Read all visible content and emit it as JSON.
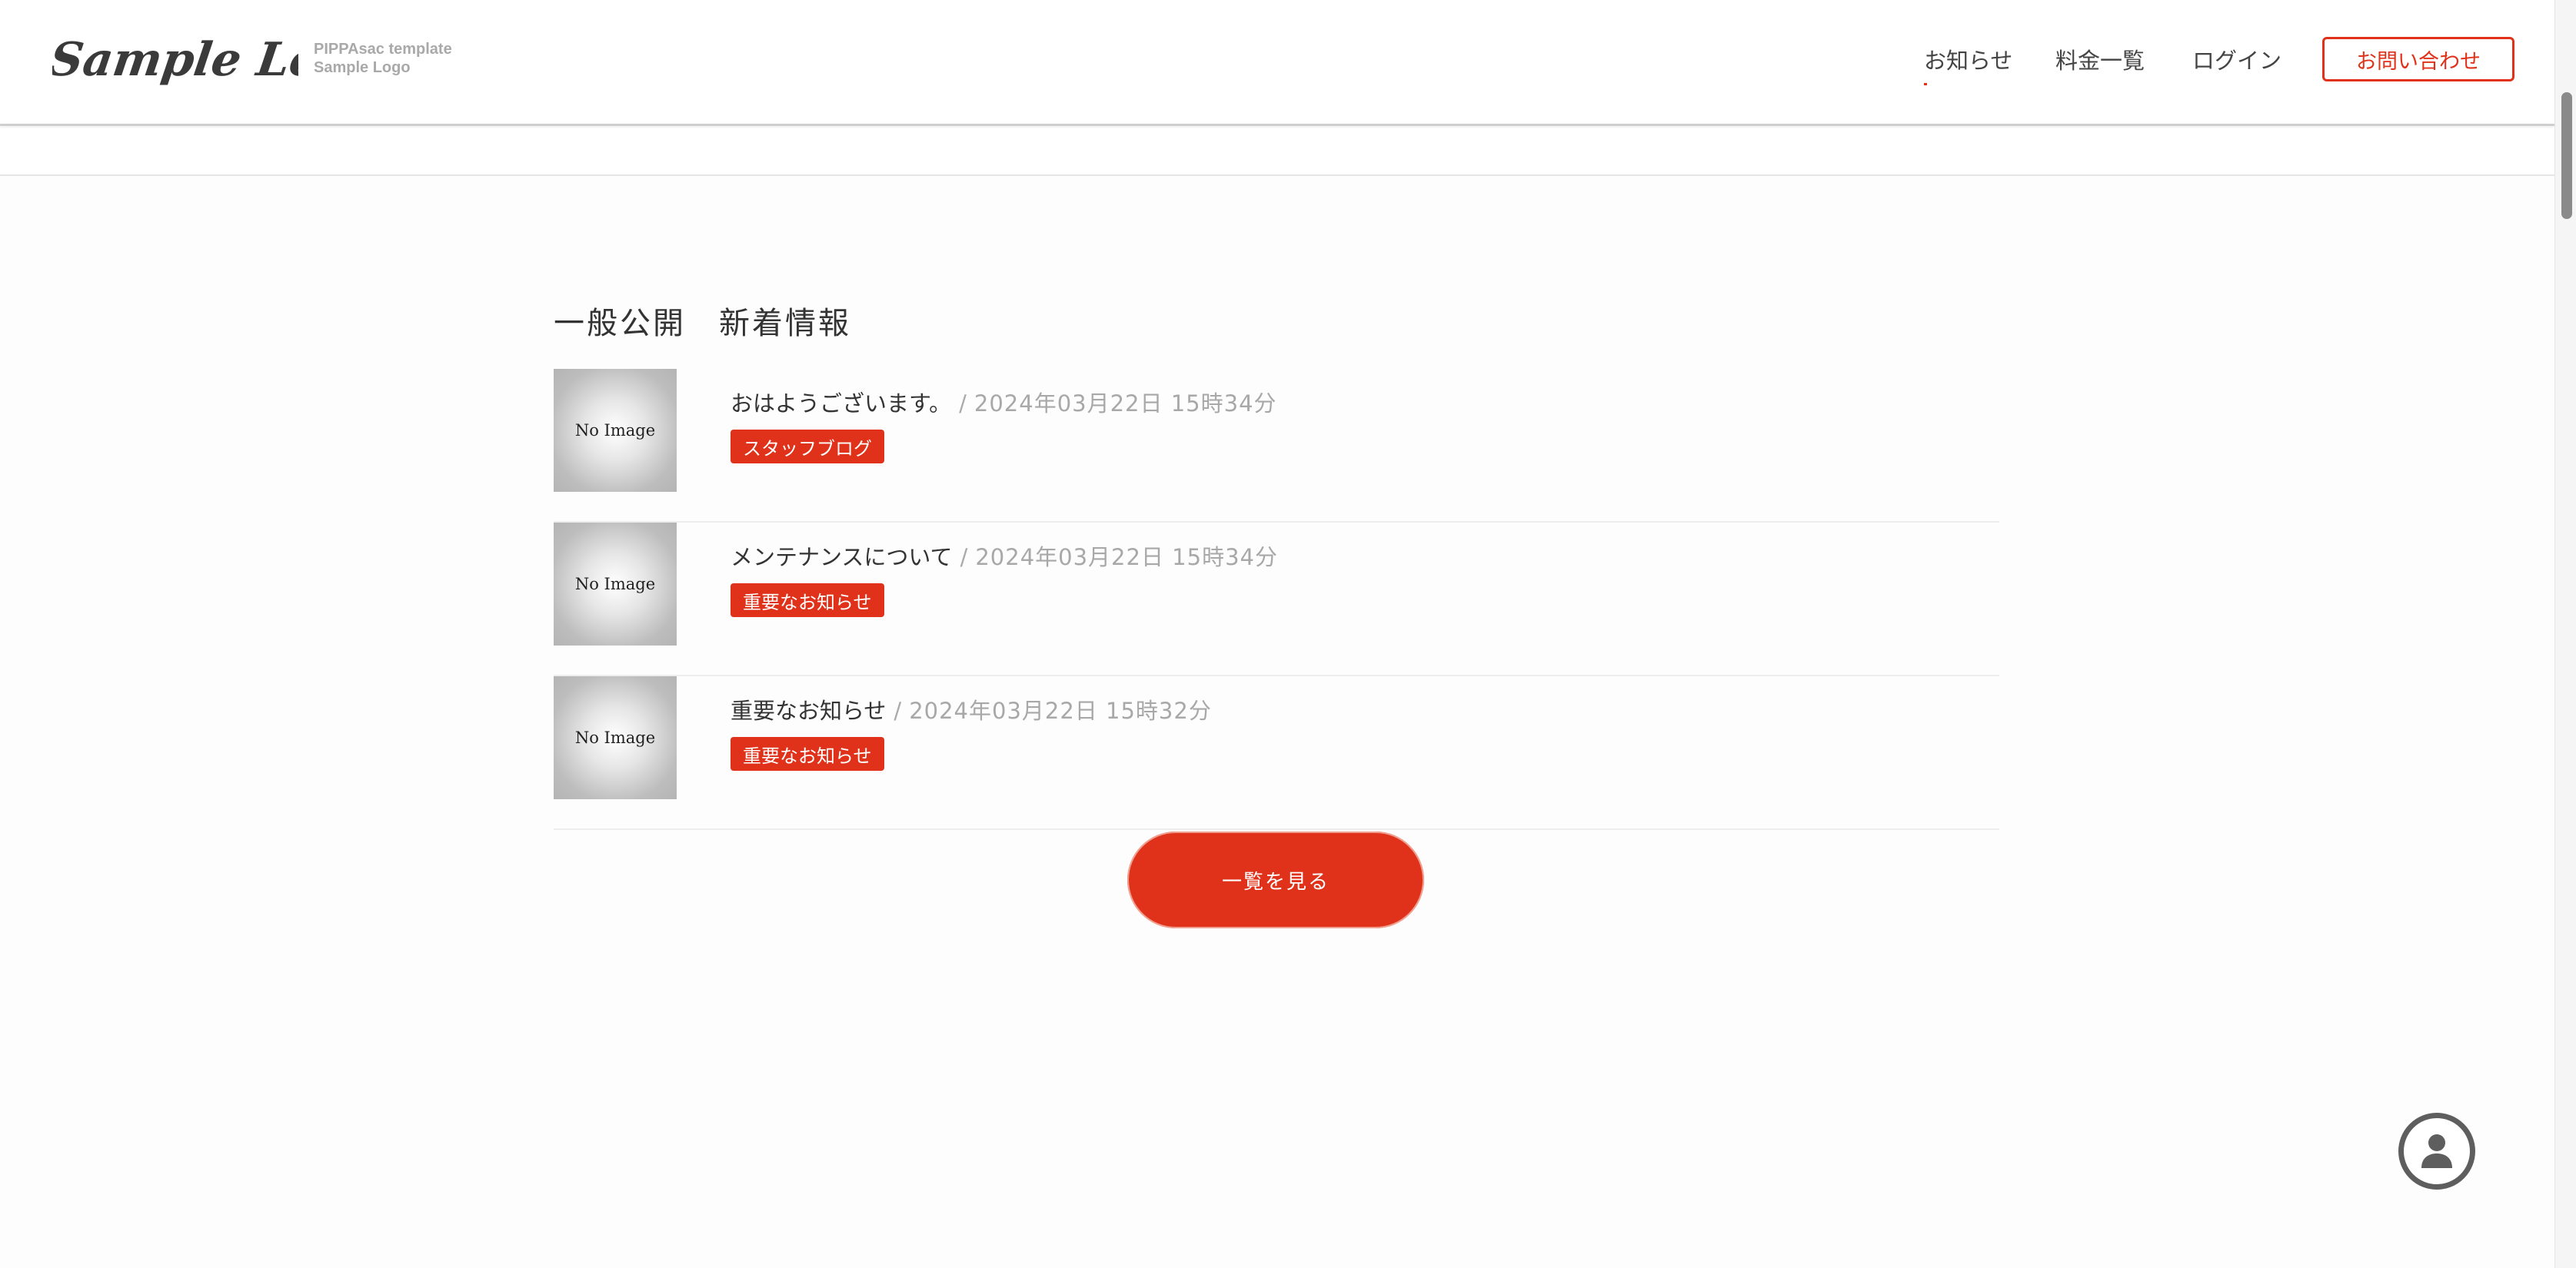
{
  "header": {
    "logo": {
      "text": "Sample Logo",
      "line1": "PIPPAsac template",
      "line2": "Sample Logo"
    },
    "nav": [
      {
        "label": "お知らせ",
        "active": true
      },
      {
        "label": "料金一覧",
        "active": false
      },
      {
        "label": "ログイン",
        "active": false
      }
    ],
    "contact_label": "お問い合わせ"
  },
  "main": {
    "section_title": "一般公開　新着情報",
    "no_image_label": "No Image",
    "separator": "/",
    "items": [
      {
        "title": "おはようございます。",
        "date": "2024年03月22日 15時34分",
        "tag": "スタッフブログ"
      },
      {
        "title": "メンテナンスについて",
        "date": "2024年03月22日 15時34分",
        "tag": "重要なお知らせ"
      },
      {
        "title": "重要なお知らせ",
        "date": "2024年03月22日 15時32分",
        "tag": "重要なお知らせ"
      }
    ],
    "more_button": "一覧を見る"
  },
  "icons": {
    "float_button": "user-icon"
  },
  "colors": {
    "accent": "#e0321a",
    "text": "#333333",
    "muted": "#a8a8a8"
  }
}
